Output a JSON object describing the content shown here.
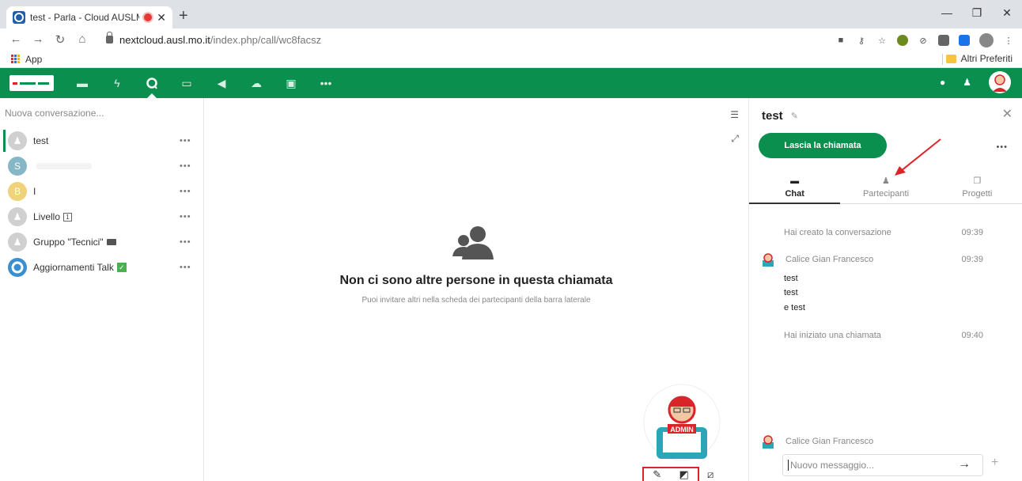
{
  "browser": {
    "tab_title": "test - Parla - Cloud AUSLMo",
    "url_host": "nextcloud.ausl.mo.it",
    "url_path": "/index.php/call/wc8facsz",
    "bookmarks_apps": "App",
    "bookmarks_other": "Altri Preferiti"
  },
  "sidebar": {
    "new_conversation_placeholder": "Nuova conversazione...",
    "conversations": [
      {
        "name": "test",
        "avatar": "",
        "avatar_color": "#d0d0d0",
        "active": true
      },
      {
        "name": "",
        "avatar": "S",
        "avatar_color": "#86b7c6",
        "active": false
      },
      {
        "name": "I",
        "avatar": "B",
        "avatar_color": "#f0d27a",
        "active": false
      },
      {
        "name": "Livello",
        "avatar": "",
        "avatar_color": "#d0d0d0",
        "active": false,
        "badge": "1"
      },
      {
        "name": "Gruppo \"Tecnici\"",
        "avatar": "",
        "avatar_color": "#d0d0d0",
        "active": false
      },
      {
        "name": "Aggiornamenti Talk",
        "avatar": "",
        "avatar_color": "#3a8fd0",
        "active": false,
        "check": "✓"
      }
    ],
    "more_label": "•••"
  },
  "call": {
    "empty_title": "Non ci sono altre persone in questa chiamata",
    "empty_subtitle": "Puoi invitare altri nella scheda dei partecipanti della barra laterale",
    "admin_label": "ADMIN"
  },
  "right_sidebar": {
    "title": "test",
    "leave_button": "Lascia la chiamata",
    "more_label": "•••",
    "tabs": [
      {
        "label": "Chat",
        "icon": "chat-icon",
        "active": true
      },
      {
        "label": "Partecipanti",
        "icon": "participants-icon",
        "active": false
      },
      {
        "label": "Progetti",
        "icon": "projects-icon",
        "active": false
      }
    ],
    "messages": {
      "created": "Hai creato la conversazione",
      "created_time": "09:39",
      "author": "Calice Gian Francesco",
      "author_time": "09:39",
      "lines": [
        "test",
        "test",
        "e test"
      ],
      "call_started": "Hai iniziato una chiamata",
      "call_started_time": "09:40",
      "current_author": "Calice Gian Francesco"
    },
    "composer_placeholder": "Nuovo messaggio..."
  },
  "colors": {
    "brand": "#0b8f4e",
    "annotation": "#d9252a"
  }
}
